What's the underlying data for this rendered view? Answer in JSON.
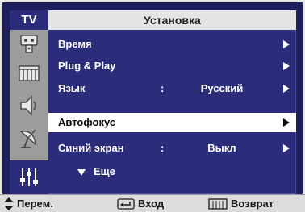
{
  "header": {
    "tv_label": "TV",
    "title": "Установка"
  },
  "sidebar": {
    "icons": [
      {
        "name": "picture-icon"
      },
      {
        "name": "channel-icon"
      },
      {
        "name": "sound-icon"
      },
      {
        "name": "antenna-icon"
      },
      {
        "name": "setup-icon",
        "active": true
      }
    ]
  },
  "menu": {
    "items": [
      {
        "label": "Время",
        "colon": "",
        "value": ""
      },
      {
        "label": "Plug & Play",
        "colon": "",
        "value": ""
      },
      {
        "label": "Язык",
        "colon": ":",
        "value": "Русский"
      },
      {
        "label": "Автофокус",
        "colon": "",
        "value": "",
        "selected": true
      },
      {
        "label": "Синий экран",
        "colon": ":",
        "value": "Выкл"
      },
      {
        "label": "Еще"
      }
    ]
  },
  "footer": {
    "move_label": "Перем.",
    "enter_label": "Вход",
    "return_label": "Возврат"
  },
  "colors": {
    "menu_background": "#2c2d7a",
    "selected_row": "#ffffff",
    "sidebar": "#9c9c9c",
    "bars": "#e4e4e4"
  }
}
